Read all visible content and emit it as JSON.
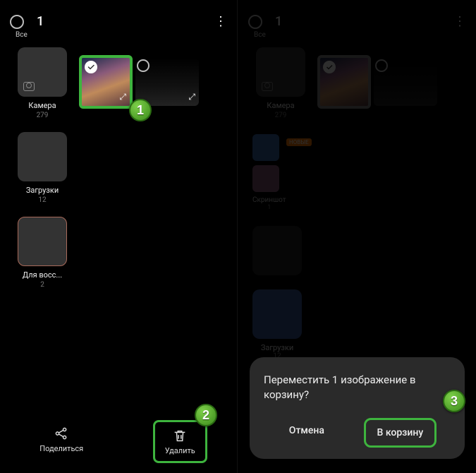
{
  "header": {
    "selected_count": "1",
    "all_label": "Все"
  },
  "albums": [
    {
      "label": "Камера",
      "count": "279"
    },
    {
      "label": "Загрузки",
      "count": "12"
    },
    {
      "label": "Для восс...",
      "count": "2"
    }
  ],
  "right_albums": [
    {
      "label": "Камера",
      "count": "279"
    },
    {
      "label": "Скриншот",
      "count": "1"
    },
    {
      "label": "Загрузки",
      "count": "12"
    }
  ],
  "new_tag": "НОВЫЕ",
  "bottom_bar": {
    "share_label": "Поделиться",
    "delete_label": "Удалить"
  },
  "dialog": {
    "message": "Переместить 1 изображение в корзину?",
    "cancel_label": "Отмена",
    "confirm_label": "В корзину"
  },
  "badges": {
    "b1": "1",
    "b2": "2",
    "b3": "3"
  }
}
